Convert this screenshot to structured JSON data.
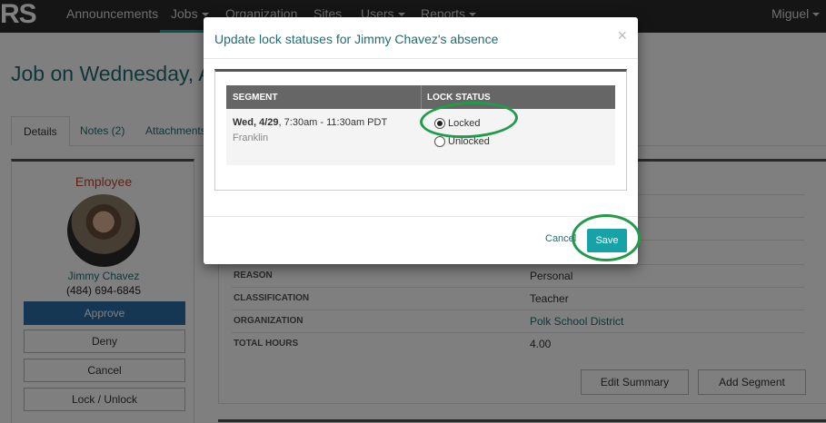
{
  "nav": {
    "logo": "RS",
    "items": [
      {
        "label": "Announcements",
        "dropdown": false
      },
      {
        "label": "Jobs",
        "dropdown": true
      },
      {
        "label": "Organization",
        "dropdown": false
      },
      {
        "label": "Sites",
        "dropdown": false
      },
      {
        "label": "Users",
        "dropdown": true
      },
      {
        "label": "Reports",
        "dropdown": true
      }
    ],
    "user": "Miguel"
  },
  "page": {
    "title": "Job on Wednesday, A",
    "tabs": [
      "Details",
      "Notes (2)",
      "Attachments"
    ]
  },
  "employee": {
    "heading": "Employee",
    "name": "Jimmy Chavez",
    "phone": "(484) 694-6845",
    "actions": [
      "Approve",
      "Deny",
      "Cancel",
      "Lock / Unlock"
    ]
  },
  "details": {
    "rows": [
      {
        "label": "REASON",
        "value": "Personal"
      },
      {
        "label": "CLASSIFICATION",
        "value": "Teacher"
      },
      {
        "label": "ORGANIZATION",
        "value": "Polk School District"
      },
      {
        "label": "TOTAL HOURS",
        "value": "4.00"
      }
    ],
    "edit_summary": "Edit Summary",
    "add_segment": "Add Segment"
  },
  "modal": {
    "title": "Update lock statuses for Jimmy Chavez's absence",
    "close": "×",
    "table": {
      "col_segment": "SEGMENT",
      "col_lock": "LOCK STATUS",
      "segment_day": "Wed, 4/29",
      "segment_time": ", 7:30am - 11:30am PDT",
      "segment_site": "Franklin",
      "options": [
        {
          "label": "Locked",
          "checked": true
        },
        {
          "label": "Unlocked",
          "checked": false
        }
      ]
    },
    "cancel": "Cancel",
    "save": "Save"
  },
  "colors": {
    "accent": "#17a2a8",
    "primary_button": "#2c6fa6",
    "highlight": "#1f9b4a"
  }
}
